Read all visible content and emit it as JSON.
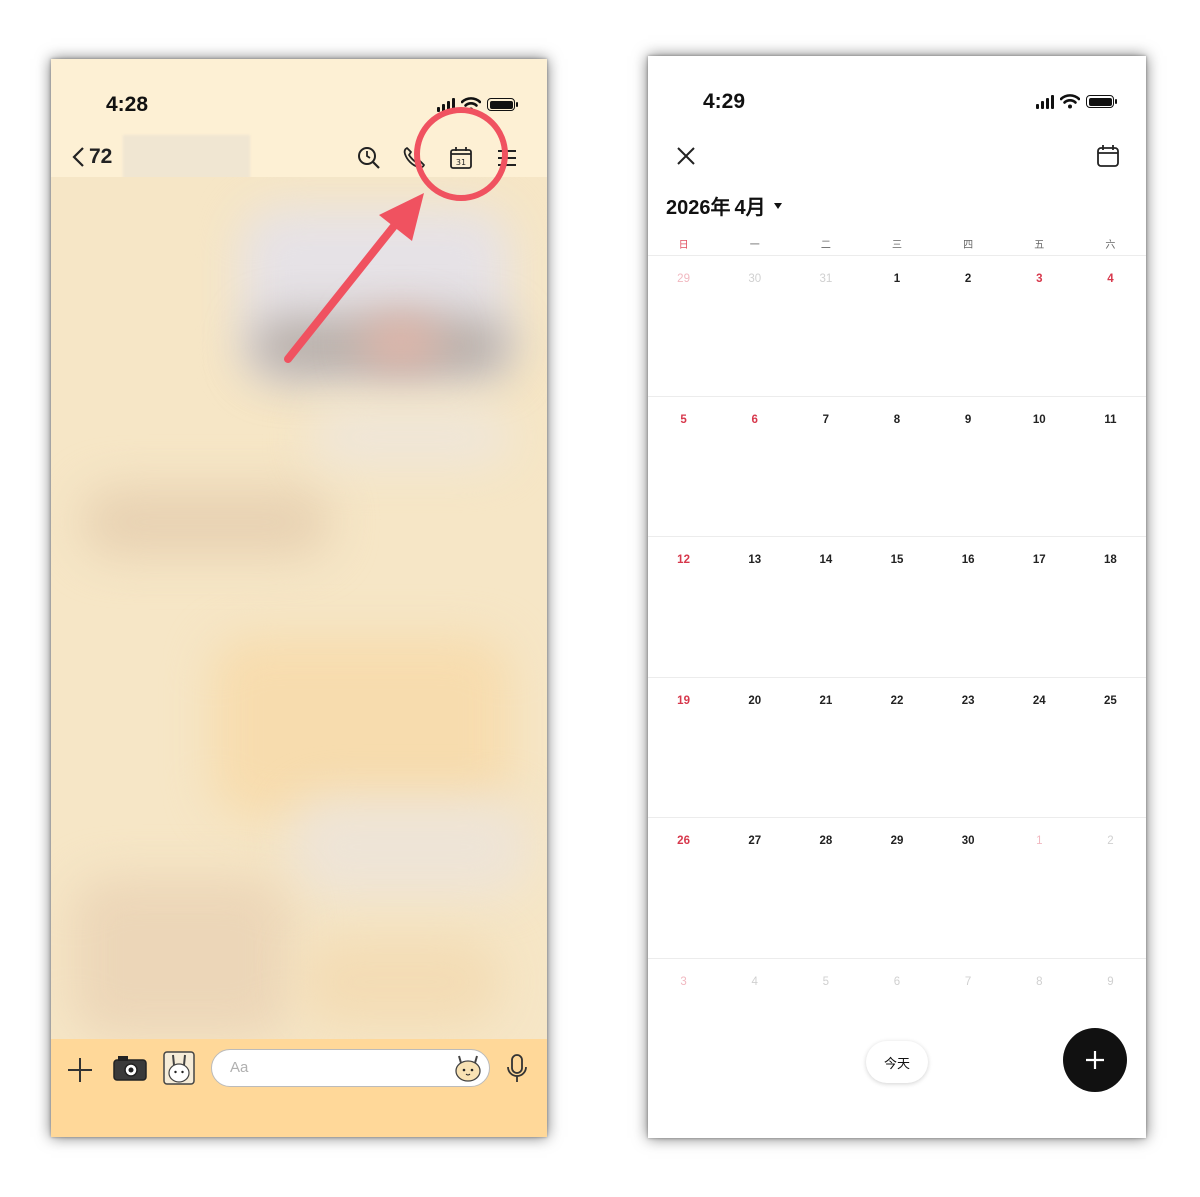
{
  "left_screen": {
    "status": {
      "time": "4:28"
    },
    "chat_header": {
      "back_count": "72"
    },
    "input": {
      "placeholder": "Aa"
    },
    "highlight_color": "#f05260"
  },
  "right_screen": {
    "status": {
      "time": "4:29"
    },
    "month_title": "2026年 4月",
    "weekdays": [
      "日",
      "一",
      "二",
      "三",
      "四",
      "五",
      "六"
    ],
    "weeks": [
      [
        {
          "d": "29",
          "t": "dimred"
        },
        {
          "d": "30",
          "t": "dim"
        },
        {
          "d": "31",
          "t": "dim"
        },
        {
          "d": "1",
          "t": "n"
        },
        {
          "d": "2",
          "t": "n"
        },
        {
          "d": "3",
          "t": "red"
        },
        {
          "d": "4",
          "t": "red"
        }
      ],
      [
        {
          "d": "5",
          "t": "red"
        },
        {
          "d": "6",
          "t": "red"
        },
        {
          "d": "7",
          "t": "n"
        },
        {
          "d": "8",
          "t": "n"
        },
        {
          "d": "9",
          "t": "n"
        },
        {
          "d": "10",
          "t": "n"
        },
        {
          "d": "11",
          "t": "n"
        }
      ],
      [
        {
          "d": "12",
          "t": "red"
        },
        {
          "d": "13",
          "t": "n"
        },
        {
          "d": "14",
          "t": "n"
        },
        {
          "d": "15",
          "t": "n"
        },
        {
          "d": "16",
          "t": "n"
        },
        {
          "d": "17",
          "t": "n"
        },
        {
          "d": "18",
          "t": "n"
        }
      ],
      [
        {
          "d": "19",
          "t": "red"
        },
        {
          "d": "20",
          "t": "n"
        },
        {
          "d": "21",
          "t": "n"
        },
        {
          "d": "22",
          "t": "n"
        },
        {
          "d": "23",
          "t": "n"
        },
        {
          "d": "24",
          "t": "n"
        },
        {
          "d": "25",
          "t": "n"
        }
      ],
      [
        {
          "d": "26",
          "t": "red"
        },
        {
          "d": "27",
          "t": "n"
        },
        {
          "d": "28",
          "t": "n"
        },
        {
          "d": "29",
          "t": "n"
        },
        {
          "d": "30",
          "t": "n"
        },
        {
          "d": "1",
          "t": "dimred"
        },
        {
          "d": "2",
          "t": "dim"
        }
      ],
      [
        {
          "d": "3",
          "t": "dimred"
        },
        {
          "d": "4",
          "t": "dim"
        },
        {
          "d": "5",
          "t": "dim"
        },
        {
          "d": "6",
          "t": "dim"
        },
        {
          "d": "7",
          "t": "dim"
        },
        {
          "d": "8",
          "t": "dim"
        },
        {
          "d": "9",
          "t": "dim"
        }
      ]
    ],
    "today_label": "今天",
    "colors": {
      "holiday_red": "#d7384c",
      "fab": "#111111"
    }
  }
}
